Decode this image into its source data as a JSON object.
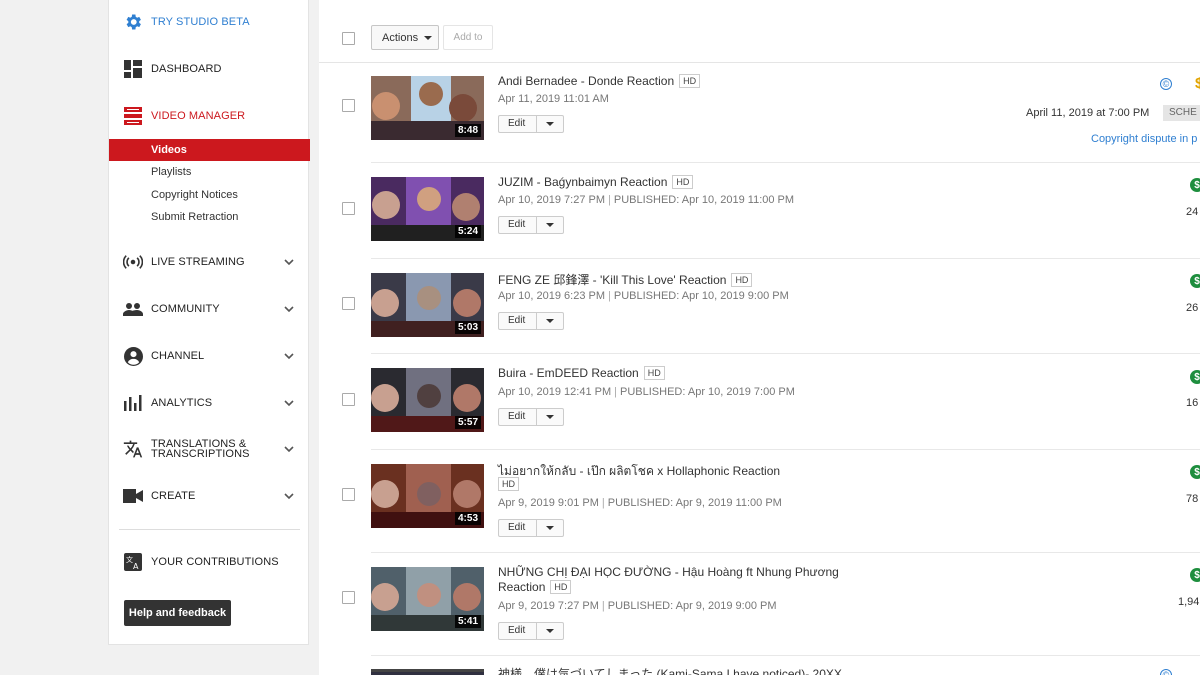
{
  "sidebar": {
    "studio_beta": "TRY STUDIO BETA",
    "dashboard": "DASHBOARD",
    "video_manager": "VIDEO MANAGER",
    "sub_items": [
      "Videos",
      "Playlists",
      "Copyright Notices",
      "Submit Retraction"
    ],
    "live_streaming": "LIVE STREAMING",
    "community": "COMMUNITY",
    "channel": "CHANNEL",
    "analytics": "ANALYTICS",
    "translations_1": "TRANSLATIONS &",
    "translations_2": "TRANSCRIPTIONS",
    "create": "CREATE",
    "contributions": "YOUR CONTRIBUTIONS",
    "help": "Help and feedback",
    "accent": "#cc181e"
  },
  "toolbar": {
    "actions": "Actions",
    "add_to": "Add to"
  },
  "videos": [
    {
      "title": "Andi Bernadee - Donde Reaction",
      "hd": "HD",
      "date": "Apr 11, 2019 11:01 AM",
      "published": "",
      "duration": "8:48",
      "edit": "Edit",
      "right": "April 11, 2019 at 7:00 PM",
      "status": "SCHE",
      "dispute": "Copyright dispute in p"
    },
    {
      "title": "JUZIM - Baǵynbaimyn Reaction",
      "hd": "HD",
      "date": "Apr 10, 2019 7:27 PM",
      "published": "PUBLISHED: Apr 10, 2019 11:00 PM",
      "duration": "5:24",
      "edit": "Edit",
      "right": "24"
    },
    {
      "title": "FENG ZE 邱鋒澤 - 'Kill This Love' Reaction",
      "hd": "HD",
      "date": "Apr 10, 2019 6:23 PM",
      "published": "PUBLISHED: Apr 10, 2019 9:00 PM",
      "duration": "5:03",
      "edit": "Edit",
      "right": "26"
    },
    {
      "title": "Buira - EmDEED Reaction",
      "hd": "HD",
      "date": "Apr 10, 2019 12:41 PM",
      "published": "PUBLISHED: Apr 10, 2019 7:00 PM",
      "duration": "5:57",
      "edit": "Edit",
      "right": "16"
    },
    {
      "title": "ไม่อยากให้กลับ - เป๊ก ผลิตโชค x Hollaphonic Reaction",
      "hd": "HD",
      "date": "Apr 9, 2019 9:01 PM",
      "published": "PUBLISHED: Apr 9, 2019 11:00 PM",
      "duration": "4:53",
      "edit": "Edit",
      "right": "78"
    },
    {
      "title": "NHỮNG CHỊ ĐẠI HỌC ĐƯỜNG - Hậu Hoàng ft Nhung Phương",
      "title2": "Reaction",
      "hd": "HD",
      "date": "Apr 9, 2019 7:27 PM",
      "published": "PUBLISHED: Apr 9, 2019 9:00 PM",
      "duration": "5:41",
      "edit": "Edit",
      "right": "1,94"
    },
    {
      "title": "神様、僕は気づいてしまった (Kami-Sama I have noticed)- 20XX"
    }
  ]
}
